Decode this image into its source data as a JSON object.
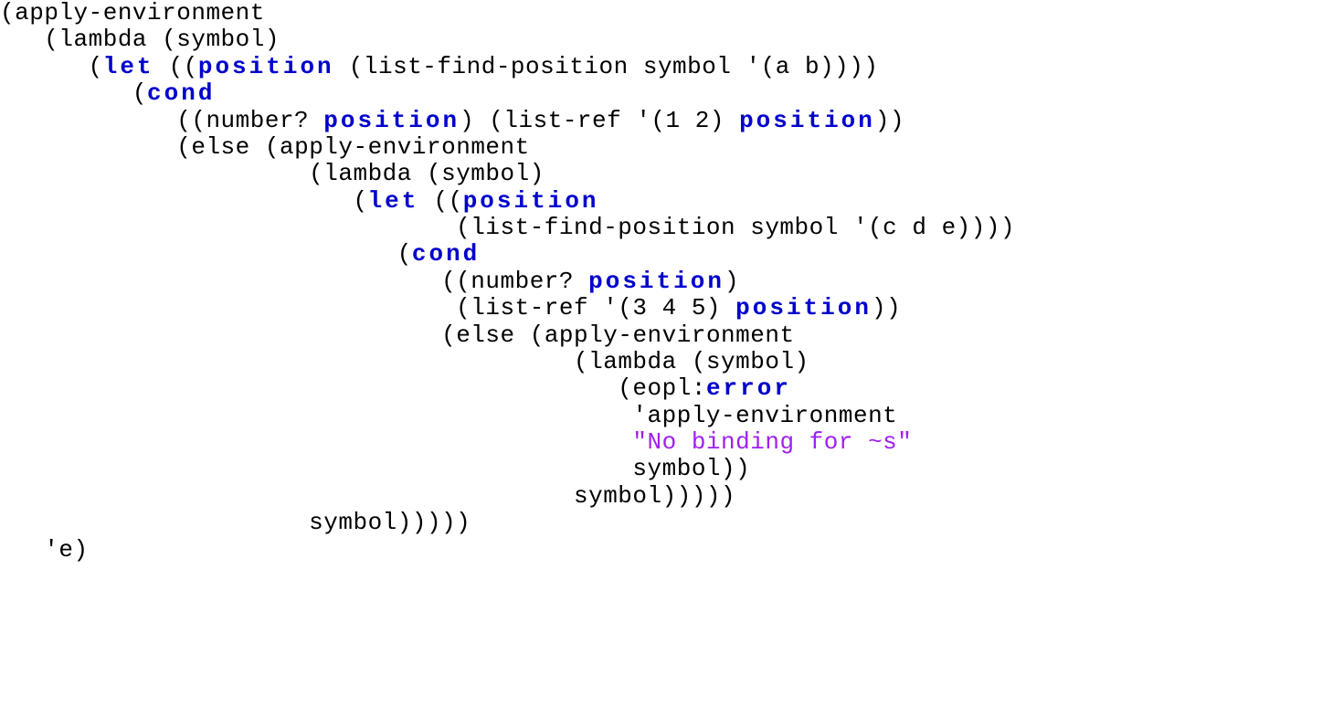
{
  "code": {
    "tokens": {
      "apply_env": "apply-environment",
      "lambda_sym": "lambda (symbol)",
      "let": "let",
      "position": "position",
      "list_find_ab": "list-find-position symbol '(a b)",
      "cond": "cond",
      "number_q": "number?",
      "list_ref_12": "list-ref '(1 2)",
      "else": "else",
      "list_find_cde": "list-find-position symbol '(c d e)",
      "list_ref_345": "list-ref '(3 4 5)",
      "eopl": "eopl",
      "error": "error",
      "quote_apply_env": "'apply-environment",
      "string_nobinding": "\"No binding for ~s\"",
      "symbol_close2": "symbol))",
      "symbol_close5_a": "symbol)))))",
      "symbol_close5_b": "symbol)))))",
      "quote_e": "'e)"
    }
  }
}
